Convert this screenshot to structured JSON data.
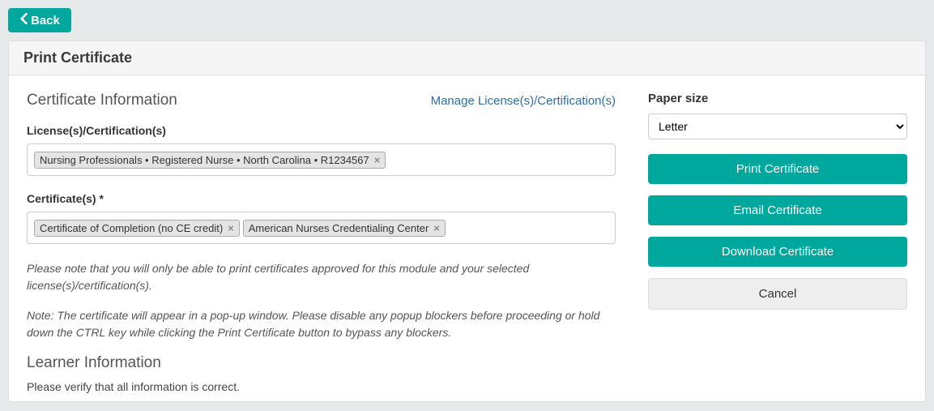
{
  "back_button": "Back",
  "panel_title": "Print Certificate",
  "cert_info": {
    "title": "Certificate Information",
    "manage_link": "Manage License(s)/Certification(s)",
    "license_label": "License(s)/Certification(s)",
    "license_tags": [
      "Nursing Professionals • Registered Nurse • North Carolina • R1234567"
    ],
    "certificate_label": "Certificate(s) *",
    "certificate_tags": [
      "Certificate of Completion (no CE credit)",
      "American Nurses Credentialing Center"
    ],
    "note1": "Please note that you will only be able to print certificates approved for this module and your selected license(s)/certification(s).",
    "note2": "Note: The certificate will appear in a pop-up window. Please disable any popup blockers before proceeding or hold down the CTRL key while clicking the Print Certificate button to bypass any blockers."
  },
  "learner_info": {
    "title": "Learner Information",
    "verify": "Please verify that all information is correct."
  },
  "sidebar": {
    "paper_size_label": "Paper size",
    "paper_size_value": "Letter",
    "print_btn": "Print Certificate",
    "email_btn": "Email Certificate",
    "download_btn": "Download Certificate",
    "cancel_btn": "Cancel"
  }
}
